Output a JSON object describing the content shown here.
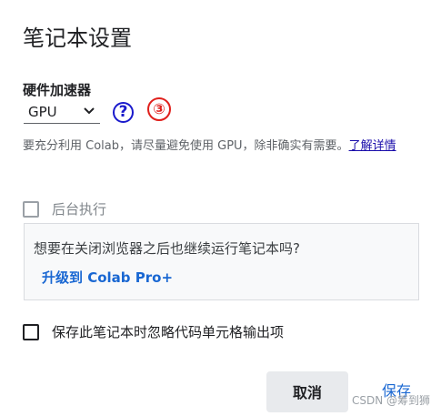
{
  "dialog": {
    "title": "笔记本设置",
    "accelerator_label": "硬件加速器",
    "accelerator_value": "GPU",
    "help_icon": "question-circle-icon",
    "marker_text": "③",
    "description": "要充分利用 Colab，请尽量避免使用 GPU，除非确实有需要。",
    "learn_more_link": "了解详情",
    "background_exec_label": "后台执行",
    "promo_text": "想要在关闭浏览器之后也继续运行笔记本吗?",
    "promo_link": "升级到 Colab Pro+",
    "omit_output_label": "保存此笔记本时忽略代码单元格输出项",
    "cancel_label": "取消",
    "save_label": "保存"
  },
  "watermark": "CSDN @筹到狮",
  "colors": {
    "accent": "#1967d2",
    "marker": "#e0201c",
    "help_icon": "#1a1acc"
  }
}
